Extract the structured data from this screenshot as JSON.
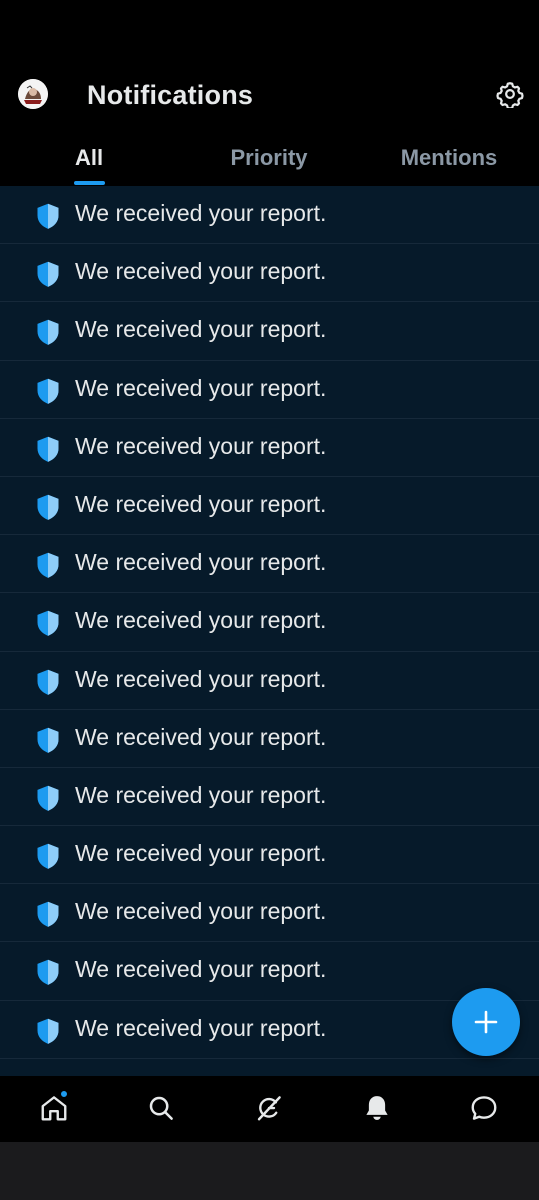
{
  "header": {
    "title": "Notifications",
    "avatar": "user-avatar",
    "settings_icon": "gear-icon"
  },
  "tabs": [
    {
      "label": "All",
      "active": true
    },
    {
      "label": "Priority",
      "active": false
    },
    {
      "label": "Mentions",
      "active": false
    }
  ],
  "notifications": [
    {
      "icon": "shield-icon",
      "text": "We received your report."
    },
    {
      "icon": "shield-icon",
      "text": "We received your report."
    },
    {
      "icon": "shield-icon",
      "text": "We received your report."
    },
    {
      "icon": "shield-icon",
      "text": "We received your report."
    },
    {
      "icon": "shield-icon",
      "text": "We received your report."
    },
    {
      "icon": "shield-icon",
      "text": "We received your report."
    },
    {
      "icon": "shield-icon",
      "text": "We received your report."
    },
    {
      "icon": "shield-icon",
      "text": "We received your report."
    },
    {
      "icon": "shield-icon",
      "text": "We received your report."
    },
    {
      "icon": "shield-icon",
      "text": "We received your report."
    },
    {
      "icon": "shield-icon",
      "text": "We received your report."
    },
    {
      "icon": "shield-icon",
      "text": "We received your report."
    },
    {
      "icon": "shield-icon",
      "text": "We received your report."
    },
    {
      "icon": "shield-icon",
      "text": "We received your report."
    },
    {
      "icon": "shield-icon",
      "text": "We received your report."
    },
    {
      "icon": "shield-icon",
      "text": ""
    }
  ],
  "fab": {
    "icon": "plus-icon"
  },
  "bottom_nav": [
    {
      "name": "home",
      "icon": "home-icon",
      "has_dot": true
    },
    {
      "name": "search",
      "icon": "search-icon"
    },
    {
      "name": "grok",
      "icon": "grok-icon"
    },
    {
      "name": "notifications",
      "icon": "bell-icon",
      "active": true
    },
    {
      "name": "messages",
      "icon": "message-icon"
    }
  ],
  "colors": {
    "accent": "#1d9bf0",
    "background": "#000000",
    "unread_row": "#061a2a",
    "text": "#e7e9ea",
    "muted": "#8b98a5"
  }
}
